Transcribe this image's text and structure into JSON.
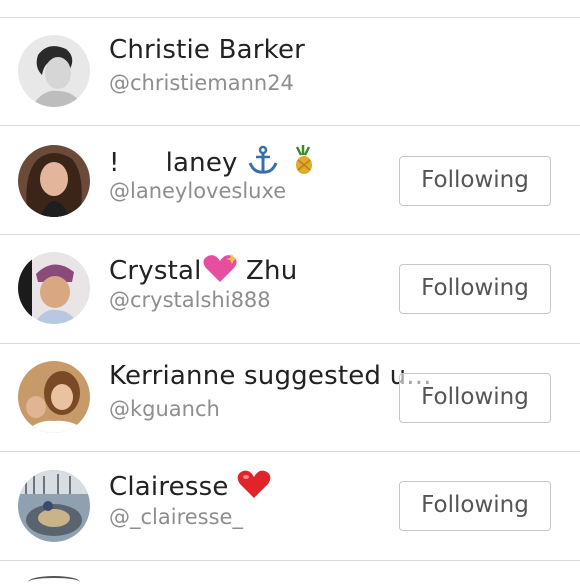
{
  "users": [
    {
      "name": "Christie Barker",
      "handle": "@christiemann24",
      "button": ""
    },
    {
      "name_prefix": "!",
      "name": "laney",
      "handle": "@laneylovesluxe",
      "button": "Following",
      "icons": [
        "anchor-icon",
        "pineapple-icon"
      ]
    },
    {
      "name": "Crystal",
      "name_suffix": "Zhu",
      "handle": "@crystalshi888",
      "button": "Following",
      "icons": [
        "sparkling-heart-icon"
      ]
    },
    {
      "name": "Kerrianne suggested u...",
      "handle": "@kguanch",
      "button": "Following"
    },
    {
      "name": "Clairesse",
      "handle": "@_clairesse_",
      "button": "Following",
      "icons": [
        "red-heart-icon"
      ]
    }
  ]
}
